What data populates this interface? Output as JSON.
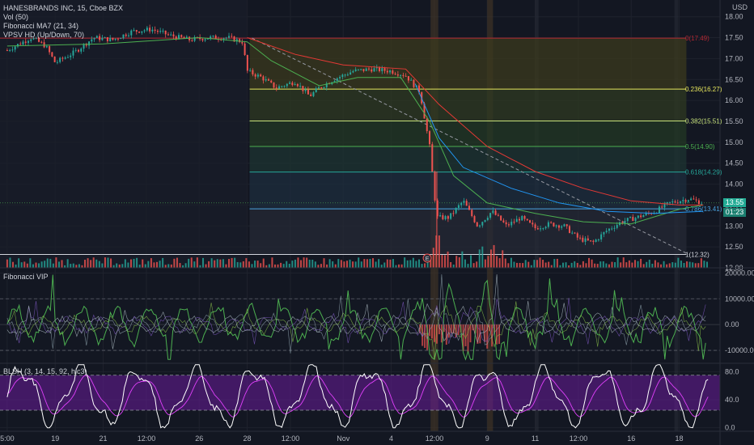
{
  "header": {
    "title": "HANESBRANDS INC, 15, Cboe BZX",
    "currency": "USD",
    "indicators": [
      "Vol (50)",
      "Fibonacci MA7 (21, 34)",
      "VPSV HD (Up/Down, 70)"
    ],
    "pane2_title": "Fibonacci VIP",
    "pane3_title": "BLSH (3, 14, 15, 92, hlc3)"
  },
  "colors": {
    "background": "#131722",
    "grid": "#1e222d",
    "candle_up": "#26a69a",
    "candle_down": "#ef5350",
    "fib_zero": "#b22833",
    "fib_line": "#e6e65c",
    "fib_green": "#4caf50",
    "fib_teal": "#26a69a",
    "fib_blue": "#4aa3df",
    "ma_fast": "#4caf50",
    "ma_slow": "#e53935",
    "ma_mid": "#2196f3",
    "oscillator_band": "#6a1b9a",
    "oscillator_line": "#ffffff",
    "oscillator_signal": "#e040fb",
    "vip_green": "#4caf50",
    "price_tag": "#22ab94"
  },
  "chart_data": [
    {
      "type": "candlestick",
      "title": "HANESBRANDS INC, 15, Cboe BZX",
      "ylabel": "USD",
      "ylim": [
        12.0,
        18.4
      ],
      "yticks": [
        "18.00",
        "17.50",
        "17.00",
        "16.50",
        "16.00",
        "15.50",
        "15.00",
        "14.50",
        "14.00",
        "13.50",
        "13.00",
        "12.50",
        "12.00"
      ],
      "xticks": [
        {
          "label": "5:00",
          "x": 0
        },
        {
          "label": "19",
          "x": 1
        },
        {
          "label": "21",
          "x": 2
        },
        {
          "label": "12:00",
          "x": 2.9
        },
        {
          "label": "26",
          "x": 4
        },
        {
          "label": "28",
          "x": 5
        },
        {
          "label": "12:00",
          "x": 5.9
        },
        {
          "label": "Nov",
          "x": 7
        },
        {
          "label": "4",
          "x": 8
        },
        {
          "label": "12:00",
          "x": 8.9
        },
        {
          "label": "9",
          "x": 10
        },
        {
          "label": "11",
          "x": 11
        },
        {
          "label": "12:00",
          "x": 11.9
        },
        {
          "label": "16",
          "x": 13
        },
        {
          "label": "18",
          "x": 14
        }
      ],
      "price_path": [
        {
          "x": 0.0,
          "y": 17.2
        },
        {
          "x": 0.5,
          "y": 17.5
        },
        {
          "x": 0.8,
          "y": 17.3
        },
        {
          "x": 1.0,
          "y": 16.9
        },
        {
          "x": 1.4,
          "y": 17.15
        },
        {
          "x": 1.8,
          "y": 17.5
        },
        {
          "x": 2.2,
          "y": 17.45
        },
        {
          "x": 2.6,
          "y": 17.65
        },
        {
          "x": 3.0,
          "y": 17.7
        },
        {
          "x": 3.4,
          "y": 17.55
        },
        {
          "x": 3.8,
          "y": 17.45
        },
        {
          "x": 4.2,
          "y": 17.5
        },
        {
          "x": 4.6,
          "y": 17.5
        },
        {
          "x": 4.9,
          "y": 17.4
        },
        {
          "x": 5.0,
          "y": 16.7
        },
        {
          "x": 5.3,
          "y": 16.55
        },
        {
          "x": 5.6,
          "y": 16.3
        },
        {
          "x": 6.0,
          "y": 16.45
        },
        {
          "x": 6.3,
          "y": 16.1
        },
        {
          "x": 6.5,
          "y": 16.3
        },
        {
          "x": 6.8,
          "y": 16.5
        },
        {
          "x": 7.2,
          "y": 16.7
        },
        {
          "x": 7.6,
          "y": 16.75
        },
        {
          "x": 8.0,
          "y": 16.7
        },
        {
          "x": 8.3,
          "y": 16.6
        },
        {
          "x": 8.6,
          "y": 16.2
        },
        {
          "x": 8.8,
          "y": 14.9
        },
        {
          "x": 8.95,
          "y": 13.2
        },
        {
          "x": 9.2,
          "y": 13.2
        },
        {
          "x": 9.5,
          "y": 13.6
        },
        {
          "x": 9.8,
          "y": 13.0
        },
        {
          "x": 10.1,
          "y": 13.35
        },
        {
          "x": 10.4,
          "y": 13.0
        },
        {
          "x": 10.7,
          "y": 13.2
        },
        {
          "x": 11.0,
          "y": 12.95
        },
        {
          "x": 11.3,
          "y": 13.05
        },
        {
          "x": 11.6,
          "y": 13.0
        },
        {
          "x": 11.9,
          "y": 12.7
        },
        {
          "x": 12.2,
          "y": 12.6
        },
        {
          "x": 12.5,
          "y": 12.9
        },
        {
          "x": 12.8,
          "y": 13.1
        },
        {
          "x": 13.1,
          "y": 13.2
        },
        {
          "x": 13.5,
          "y": 13.35
        },
        {
          "x": 13.8,
          "y": 13.55
        },
        {
          "x": 14.2,
          "y": 13.65
        },
        {
          "x": 14.5,
          "y": 13.55
        }
      ],
      "moving_averages": [
        {
          "name": "fast",
          "color": "#4caf50",
          "points": [
            {
              "x": 0,
              "y": 17.3
            },
            {
              "x": 2,
              "y": 17.35
            },
            {
              "x": 4,
              "y": 17.5
            },
            {
              "x": 5,
              "y": 17.4
            },
            {
              "x": 5.5,
              "y": 16.95
            },
            {
              "x": 6.5,
              "y": 16.35
            },
            {
              "x": 7.3,
              "y": 16.55
            },
            {
              "x": 8.2,
              "y": 16.55
            },
            {
              "x": 8.8,
              "y": 15.5
            },
            {
              "x": 9.3,
              "y": 14.2
            },
            {
              "x": 10,
              "y": 13.55
            },
            {
              "x": 11,
              "y": 13.3
            },
            {
              "x": 12,
              "y": 13.1
            },
            {
              "x": 13,
              "y": 13.05
            },
            {
              "x": 14,
              "y": 13.4
            },
            {
              "x": 14.5,
              "y": 13.5
            }
          ]
        },
        {
          "name": "mid",
          "color": "#2196f3",
          "points": [
            {
              "x": 8.5,
              "y": 16.4
            },
            {
              "x": 9,
              "y": 15.1
            },
            {
              "x": 9.5,
              "y": 14.4
            },
            {
              "x": 10.5,
              "y": 13.9
            },
            {
              "x": 11.5,
              "y": 13.55
            },
            {
              "x": 12.5,
              "y": 13.35
            },
            {
              "x": 13.5,
              "y": 13.3
            },
            {
              "x": 14.5,
              "y": 13.35
            }
          ]
        },
        {
          "name": "slow",
          "color": "#e53935",
          "points": [
            {
              "x": 5,
              "y": 17.5
            },
            {
              "x": 6,
              "y": 17.1
            },
            {
              "x": 7,
              "y": 16.85
            },
            {
              "x": 8.3,
              "y": 16.75
            },
            {
              "x": 9,
              "y": 15.9
            },
            {
              "x": 10,
              "y": 14.9
            },
            {
              "x": 11,
              "y": 14.3
            },
            {
              "x": 12,
              "y": 13.9
            },
            {
              "x": 13,
              "y": 13.6
            },
            {
              "x": 14,
              "y": 13.5
            },
            {
              "x": 14.5,
              "y": 13.5
            }
          ]
        }
      ],
      "fibonacci": {
        "x_start": 5.05,
        "x_end": 14.15,
        "levels": [
          {
            "label": "0(17.49)",
            "value": 17.49,
            "color": "#b22833"
          },
          {
            "label": "0.236(16.27)",
            "value": 16.27,
            "color": "#e6e65c"
          },
          {
            "label": "0.382(15.51)",
            "value": 15.51,
            "color": "#c6e07a"
          },
          {
            "label": "0.5(14.90)",
            "value": 14.9,
            "color": "#4caf50"
          },
          {
            "label": "0.618(14.29)",
            "value": 14.29,
            "color": "#26a69a"
          },
          {
            "label": "0.786(13.41)",
            "value": 13.41,
            "color": "#4aa3df"
          },
          {
            "label": "1(12.32)",
            "value": 12.32,
            "color": "#d1d4dc"
          }
        ]
      },
      "trend_line": [
        {
          "x": 5.1,
          "y": 17.49
        },
        {
          "x": 14.2,
          "y": 12.32
        }
      ],
      "last_price": "13.55",
      "countdown": "01:23",
      "event_marker": "E"
    },
    {
      "type": "area",
      "title": "Fibonacci VIP",
      "ylim": [
        -15000,
        22000
      ],
      "yticks": [
        "20000.00",
        "10000.00",
        "0.00",
        "-10000.00"
      ],
      "dashed_levels": [
        10000,
        -10000
      ]
    },
    {
      "type": "line",
      "title": "BLSH (3, 14, 15, 92, hlc3)",
      "ylim": [
        -5,
        92
      ],
      "yticks": [
        "80.0",
        "40.0",
        "0.0"
      ],
      "band": [
        25,
        75
      ],
      "dashed_levels": [
        25,
        75
      ]
    }
  ]
}
